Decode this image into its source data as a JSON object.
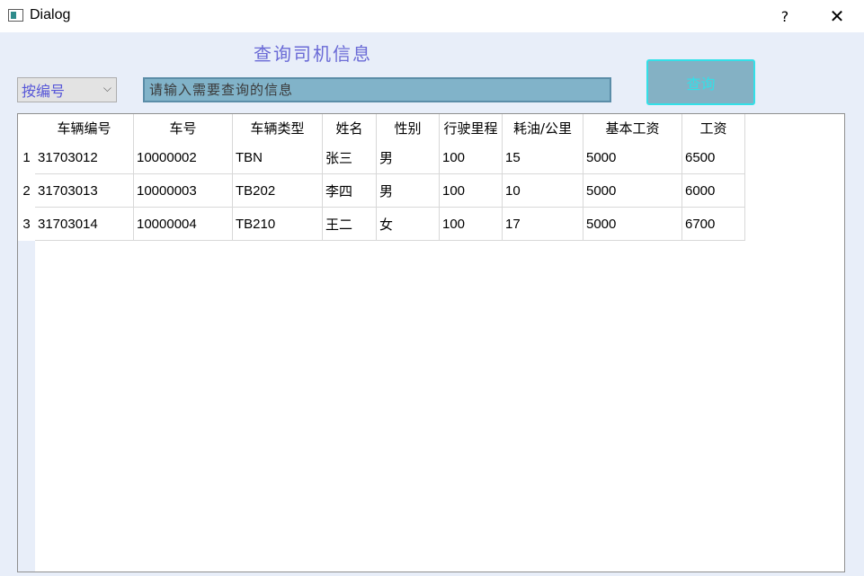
{
  "window": {
    "title": "Dialog",
    "help_label": "?",
    "close_label": "✕"
  },
  "heading": "查询司机信息",
  "filter": {
    "selected": "按编号",
    "chevron": "⌵"
  },
  "search": {
    "placeholder": "请输入需要查询的信息",
    "value": ""
  },
  "query_button": "查询",
  "table": {
    "columns": [
      "车辆编号",
      "车号",
      "车辆类型",
      "姓名",
      "性别",
      "行驶里程",
      "耗油/公里",
      "基本工资",
      "工资"
    ],
    "row_numbers": [
      "1",
      "2",
      "3"
    ],
    "rows": [
      [
        "31703012",
        "10000002",
        "TBN",
        "张三",
        "男",
        "100",
        "15",
        "5000",
        "6500"
      ],
      [
        "31703013",
        "10000003",
        "TB202",
        "李四",
        "男",
        "100",
        "10",
        "5000",
        "6000"
      ],
      [
        "31703014",
        "10000004",
        "TB210",
        "王二",
        "女",
        "100",
        "17",
        "5000",
        "6700"
      ]
    ]
  }
}
